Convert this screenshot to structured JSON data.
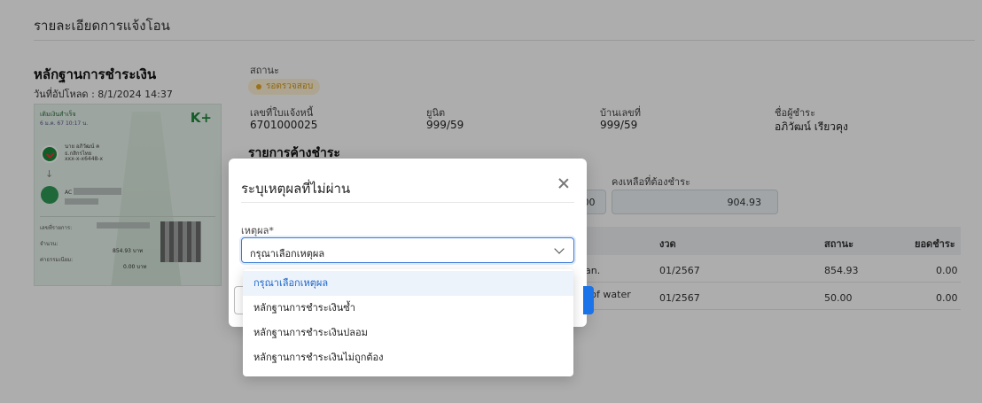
{
  "page": {
    "title": "รายละเอียดการแจ้งโอน"
  },
  "evidence": {
    "title": "หลักฐานการชำระเงิน",
    "upload_date": "วันที่อัปโหลด : 8/1/2024 14:37"
  },
  "slip": {
    "header": "เติมเงินสำเร็จ",
    "date": "6 ม.ค. 67 10:17 น.",
    "brand": "K+",
    "sender_name": "นาย อภิวัฒน์ ค",
    "sender_bank": "ธ.กสิกรไทย",
    "sender_account": "xxx-x-x6448-x",
    "receiver_prefix": "AC",
    "ref_label": "เลขที่รายการ:",
    "amount_label": "จำนวน:",
    "amount": "854.93 บาท",
    "fee_label": "ค่าธรรมเนียม:",
    "fee": "0.00 บาท"
  },
  "info": {
    "status_label": "สถานะ",
    "status_value": "รอตรวจสอบ",
    "status_color": "#e5a82a",
    "bill_label": "เลขที่ใบแจ้งหนี้",
    "bill_value": "6701000025",
    "unit_label": "ยูนิต",
    "unit_value": "999/59",
    "house_label": "บ้านเลขที่",
    "house_value": "999/59",
    "payer_label": "ชื่อผู้ชำระ",
    "payer_value": "อภิวัฒน์ เรียวคุง"
  },
  "outstanding": {
    "title": "รายการค้างชำระ",
    "prev_value": ".00",
    "remain_label": "คงเหลือที่ต้องชำระ",
    "remain_value": "904.93"
  },
  "table": {
    "headers": {
      "period": "งวด",
      "status": "สถานะ",
      "paid": "ยอดชำระ"
    },
    "rows": [
      {
        "desc": "an.",
        "period": "01/2567",
        "status": "854.93",
        "paid": "0.00"
      },
      {
        "desc": "ce of water",
        "period": "01/2567",
        "status": "50.00",
        "paid": "0.00"
      }
    ]
  },
  "modal": {
    "title": "ระบุเหตุผลที่ไม่ผ่าน",
    "field_label": "เหตุผล*",
    "selected": "กรุณาเลือกเหตุผล",
    "options": [
      "กรุณาเลือกเหตุผล",
      "หลักฐานการชำระเงินซ้ำ",
      "หลักฐานการชำระเงินปลอม",
      "หลักฐานการชำระเงินไม่ถูกต้อง"
    ],
    "accent_color": "#1a73e8"
  }
}
